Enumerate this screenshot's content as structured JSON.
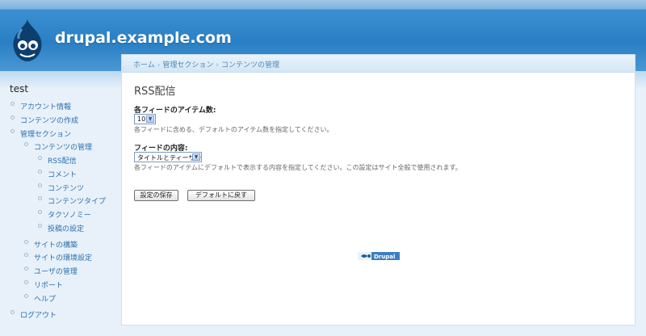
{
  "header": {
    "site_name": "drupal.example.com",
    "brand_color": "#2a7fc4"
  },
  "breadcrumb": [
    "ホーム",
    "管理セクション",
    "コンテンツの管理"
  ],
  "sidebar": {
    "title": "test",
    "items": [
      {
        "label": "アカウント情報"
      },
      {
        "label": "コンテンツの作成"
      },
      {
        "label": "管理セクション"
      },
      {
        "label": "コンテンツの管理"
      },
      {
        "label": "RSS配信"
      },
      {
        "label": "コメント"
      },
      {
        "label": "コンテンツ"
      },
      {
        "label": "コンテンツタイプ"
      },
      {
        "label": "タクソノミー"
      },
      {
        "label": "投稿の設定"
      },
      {
        "label": "サイトの構築"
      },
      {
        "label": "サイトの環境設定"
      },
      {
        "label": "ユーザの管理"
      },
      {
        "label": "リポート"
      },
      {
        "label": "ヘルプ"
      },
      {
        "label": "ログアウト"
      }
    ]
  },
  "main": {
    "title": "RSS配信",
    "items_label": "各フィードのアイテム数:",
    "items_value": "10",
    "items_desc": "各フィードに含める、デフォルトのアイテム数を指定してください。",
    "content_label": "フィードの内容:",
    "content_value": "タイトルとティーザー",
    "content_desc": "各フィードのアイテムにデフォルトで表示する内容を指定してください。この設定はサイト全般で使用されます。",
    "save_button": "設定の保存",
    "reset_button": "デフォルトに戻す",
    "powered_by": "Drupal"
  }
}
